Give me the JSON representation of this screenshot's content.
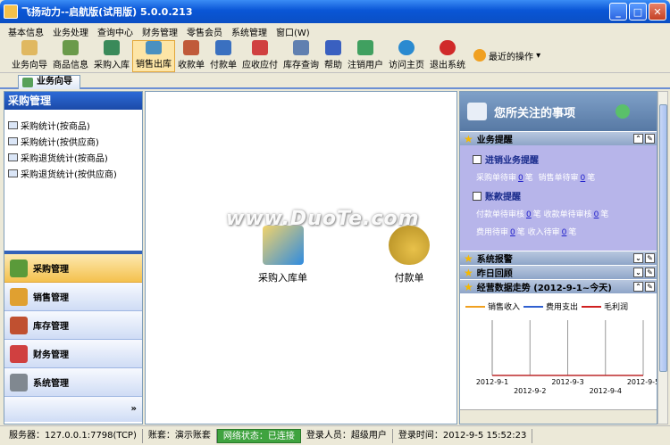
{
  "window": {
    "title": "飞扬动力--启航版(试用版)    5.0.0.213"
  },
  "menu": [
    "基本信息",
    "业务处理",
    "查询中心",
    "财务管理",
    "零售会员",
    "系统管理",
    "窗口(W)"
  ],
  "toolbar": [
    {
      "label": "业务向导",
      "icon": "guide-icon"
    },
    {
      "label": "商品信息",
      "icon": "product-icon"
    },
    {
      "label": "采购入库",
      "icon": "purchase-icon"
    },
    {
      "label": "销售出库",
      "icon": "sales-icon",
      "active": true
    },
    {
      "label": "收款单",
      "icon": "receipt-icon"
    },
    {
      "label": "付款单",
      "icon": "payment-icon"
    },
    {
      "label": "应收应付",
      "icon": "ar-ap-icon"
    },
    {
      "label": "库存查询",
      "icon": "inventory-icon"
    },
    {
      "label": "帮助",
      "icon": "help-icon"
    },
    {
      "label": "注销用户",
      "icon": "logout-icon"
    },
    {
      "label": "访问主页",
      "icon": "homepage-icon"
    },
    {
      "label": "退出系统",
      "icon": "exit-icon"
    }
  ],
  "recent": "最近的操作",
  "tab": "业务向导",
  "left": {
    "title": "采购管理",
    "items": [
      "采购统计(按商品)",
      "采购统计(按供应商)",
      "采购退货统计(按商品)",
      "采购退货统计(按供应商)"
    ],
    "nav": [
      "采购管理",
      "销售管理",
      "库存管理",
      "财务管理",
      "系统管理"
    ],
    "more": "»"
  },
  "center": {
    "shortcuts": [
      "采购入库单",
      "付款单"
    ],
    "watermark": "www.DuoTe.com"
  },
  "right": {
    "banner": "您所关注的事项",
    "sections": {
      "biz": "业务提醒",
      "alarm": "系统报警",
      "yesterday": "昨日回顾",
      "trend": "经营数据走势 (2012-9-1~今天)"
    },
    "biz_sub1": "进销业务提醒",
    "biz_line1": {
      "a": "采购单待审",
      "a_n": "0",
      "a_u": "笔",
      "b": "销售单待审",
      "b_n": "0",
      "b_u": "笔"
    },
    "biz_sub2": "账款提醒",
    "biz_line2": {
      "a": "付款单待审核",
      "a_n": "0",
      "a_u": "笔",
      "b": "收款单待审核",
      "b_n": "0",
      "b_u": "笔"
    },
    "biz_line3": {
      "a": "费用待审",
      "a_n": "0",
      "a_u": "笔",
      "b": "收入待审",
      "b_n": "0",
      "b_u": "笔"
    }
  },
  "chart_data": {
    "type": "line",
    "title": "",
    "series": [
      {
        "name": "销售收入",
        "color": "#f0a020",
        "values": [
          0,
          0,
          0,
          0,
          0
        ]
      },
      {
        "name": "费用支出",
        "color": "#3060d0",
        "values": [
          0,
          0,
          0,
          0,
          0
        ]
      },
      {
        "name": "毛利润",
        "color": "#d02020",
        "values": [
          0,
          0,
          0,
          0,
          0
        ]
      }
    ],
    "x": [
      "2012-9-1",
      "2012-9-2",
      "2012-9-3",
      "2012-9-4",
      "2012-9-5"
    ]
  },
  "status": {
    "server": "服务器：127.0.0.1:7798(TCP)",
    "account": "账套：演示账套",
    "network": "网络状态：已连接",
    "user": "登录人员：超级用户",
    "login_time": "登录时间：2012-9-5 15:52:23"
  }
}
